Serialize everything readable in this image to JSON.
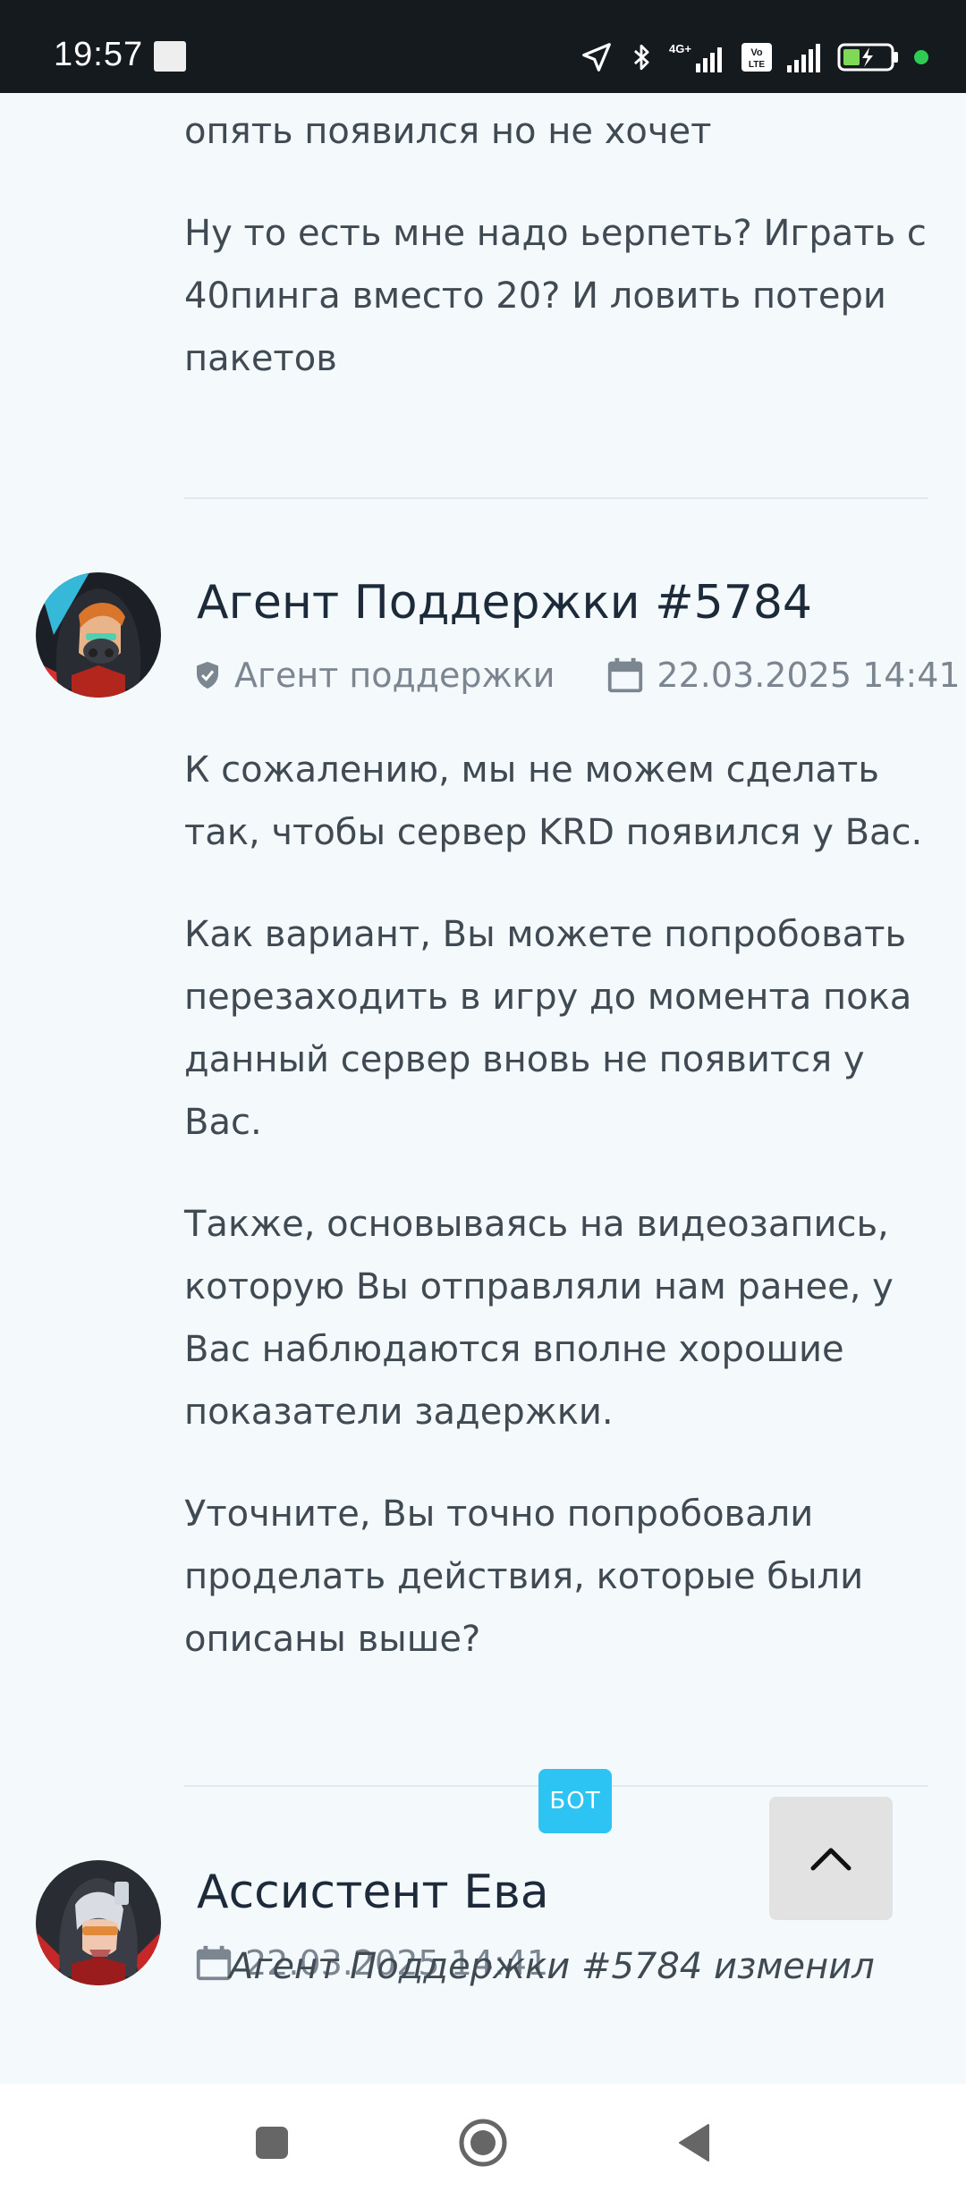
{
  "status_bar": {
    "time": "19:57",
    "icons": [
      "notification-square-icon",
      "location-arrow-icon",
      "bluetooth-icon",
      "signal-4g-icon",
      "volte-icon",
      "signal-icon",
      "battery-charging-icon",
      "green-dot-icon"
    ]
  },
  "messages": [
    {
      "paragraphs": [
        "опять появился но не хочет",
        "Ну то есть мне надо ьерпеть? Играть с 40пинга вместо 20? И ловить потери пакетов"
      ]
    },
    {
      "author": "Агент Поддержки #5784",
      "role": "Агент поддержки",
      "date": "22.03.2025 14:41",
      "paragraphs": [
        "К сожалению, мы не можем сделать так, чтобы сервер KRD появился у Вас.",
        "Как вариант, Вы можете попробовать перезаходить в игру до момента пока данный сервер вновь не появится у Вас.",
        "Также, основываясь на видеозапись, которую Вы отправляли нам ранее, у Вас наблюдаются вполне хорошие показатели задержки.",
        "Уточните, Вы точно попробовали проделать действия, которые были описаны выше?"
      ]
    },
    {
      "author": "Ассистент Ева",
      "badge": "БОТ",
      "date": "22.03.2025 14:41",
      "paragraphs": [
        "Агент Поддержки #5784 изменил"
      ]
    }
  ],
  "colors": {
    "background": "#f4f9fc",
    "text": "#3f4a52",
    "name": "#1c2a3a",
    "meta": "#7b8690",
    "bot_badge": "#2dc3f2",
    "scroll_button": "#e2e2e2"
  },
  "nav_bar": {
    "icons": [
      "recent-apps-icon",
      "home-icon",
      "back-icon"
    ]
  }
}
